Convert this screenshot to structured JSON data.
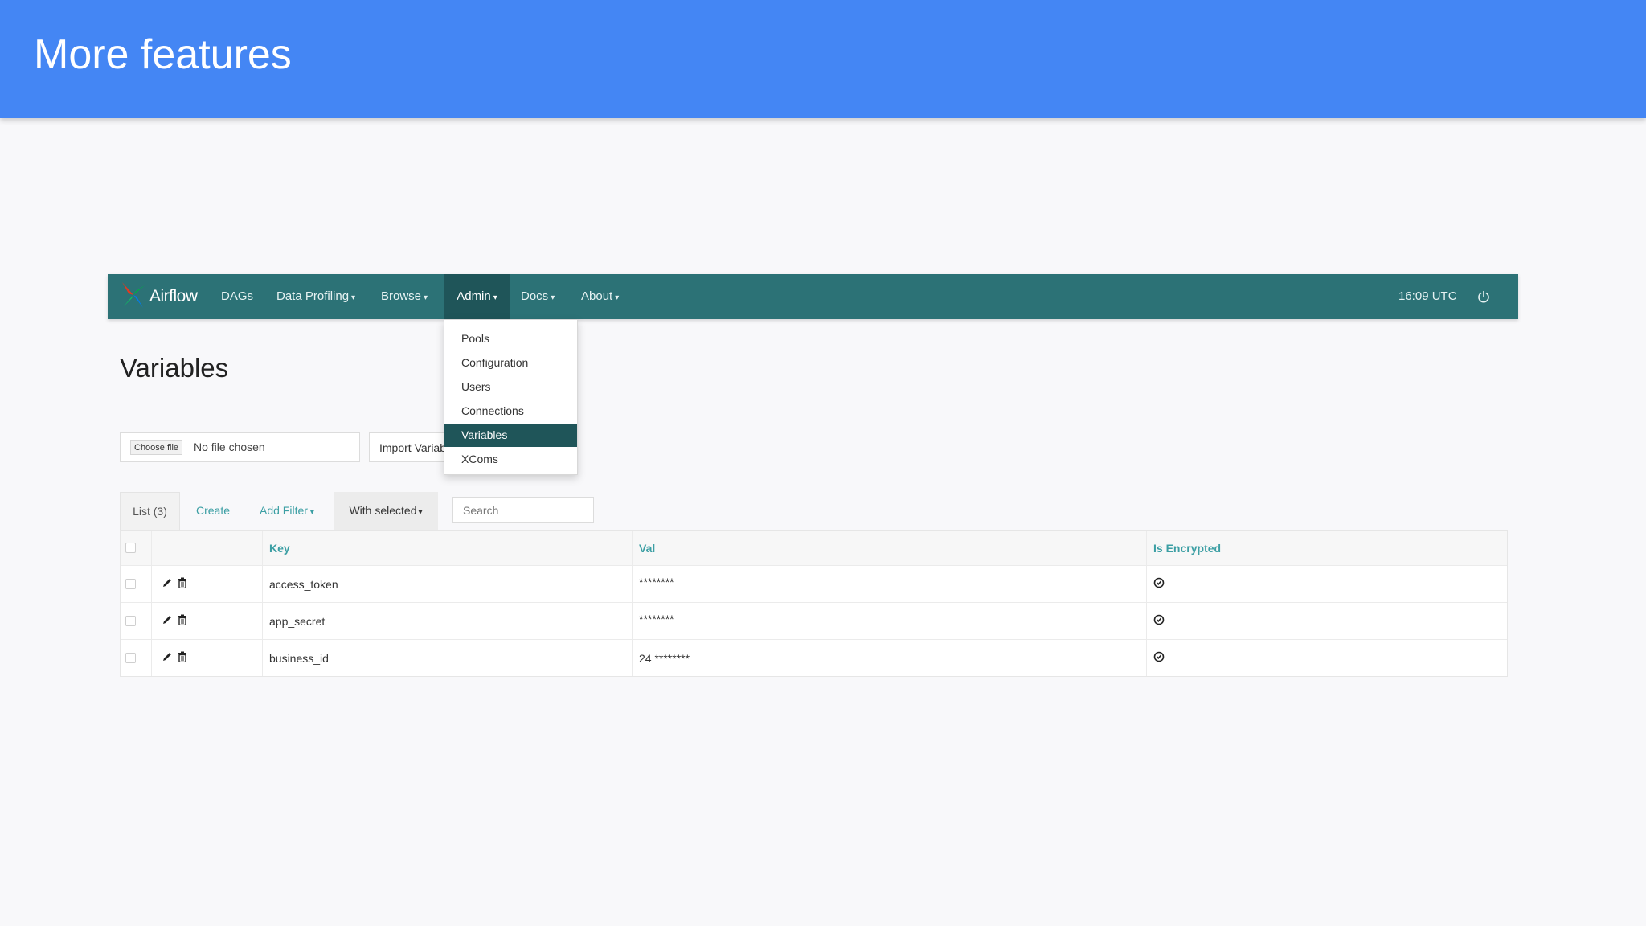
{
  "slide": {
    "title": "More features"
  },
  "navbar": {
    "brand": "Airflow",
    "items": [
      {
        "label": "DAGs",
        "caret": false
      },
      {
        "label": "Data Profiling",
        "caret": true
      },
      {
        "label": "Browse",
        "caret": true
      },
      {
        "label": "Admin",
        "caret": true,
        "active": true
      },
      {
        "label": "Docs",
        "caret": true
      },
      {
        "label": "About",
        "caret": true
      }
    ],
    "time": "16:09 UTC",
    "icons": {
      "logo": "airflow-pinwheel-icon",
      "power": "power-icon"
    },
    "colors": {
      "bar": "#2c7276",
      "active": "#1f5559"
    }
  },
  "admin_menu": {
    "items": [
      "Pools",
      "Configuration",
      "Users",
      "Connections",
      "Variables",
      "XComs"
    ],
    "active": "Variables"
  },
  "page": {
    "title": "Variables",
    "file_button": "Choose file",
    "file_status": "No file chosen",
    "import_button": "Import Variables"
  },
  "toolbar": {
    "list_tab": "List (3)",
    "create": "Create",
    "add_filter": "Add Filter",
    "with_selected": "With selected",
    "search_placeholder": "Search"
  },
  "table": {
    "headers": {
      "key": "Key",
      "val": "Val",
      "encrypted": "Is Encrypted"
    },
    "rows": [
      {
        "key": "access_token",
        "val": "********"
      },
      {
        "key": "app_secret",
        "val": "********"
      },
      {
        "key": "business_id",
        "val": "24 ********"
      }
    ],
    "icons": {
      "edit": "pencil-icon",
      "delete": "trash-icon",
      "encrypted": "check-circle-icon"
    }
  }
}
